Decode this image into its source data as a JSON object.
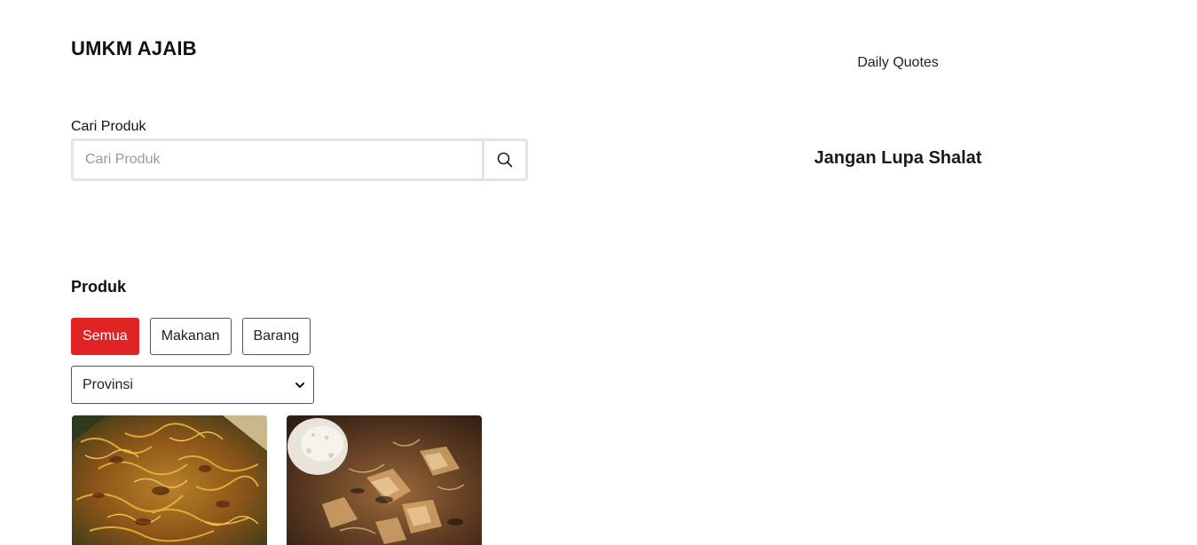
{
  "header": {
    "brand": "UMKM AJAIB"
  },
  "quotes": {
    "label": "Daily Quotes",
    "text": "Jangan Lupa Shalat"
  },
  "search": {
    "label": "Cari Produk",
    "placeholder": "Cari Produk",
    "value": "",
    "button_icon": "search-icon"
  },
  "products": {
    "title": "Produk",
    "filters": [
      "Semua",
      "Makanan",
      "Barang"
    ],
    "active_filter": "Semua",
    "province_select": {
      "selected": "Provinsi",
      "icon": "chevron-down-icon"
    },
    "cards": [
      {
        "image": "fried-noodle-photo"
      },
      {
        "image": "food-with-crackers-photo"
      }
    ]
  },
  "colors": {
    "accent": "#e02424",
    "border": "#e3e4e8",
    "text": "#111111"
  }
}
